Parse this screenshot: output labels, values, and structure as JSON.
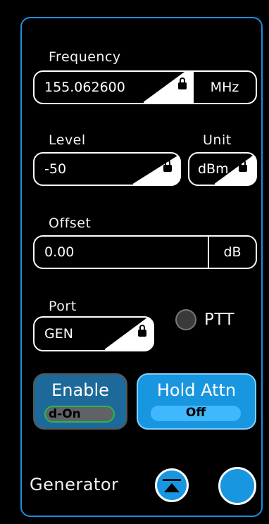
{
  "frequency": {
    "label": "Frequency",
    "value": "155.062600",
    "unit": "MHz"
  },
  "level": {
    "label": "Level",
    "value": "-50"
  },
  "unit": {
    "label": "Unit",
    "value": "dBm"
  },
  "offset": {
    "label": "Offset",
    "value": "0.00",
    "unit": "dB"
  },
  "port": {
    "label": "Port",
    "value": "GEN"
  },
  "ptt": {
    "label": "PTT"
  },
  "enable_button": {
    "title": "Enable",
    "state": "d-On"
  },
  "hold_attn_button": {
    "title": "Hold Attn",
    "state": "Off"
  },
  "footer": {
    "title": "Generator"
  },
  "colors": {
    "accent": "#1c8fe0",
    "button_blue": "#1996e0",
    "enable_blue": "#1d6a9a",
    "state_green": "#2fb54a"
  },
  "icons": {
    "lock": "lock-icon",
    "collapse": "collapse-up-icon",
    "ptt_indicator": "circle-indicator"
  }
}
